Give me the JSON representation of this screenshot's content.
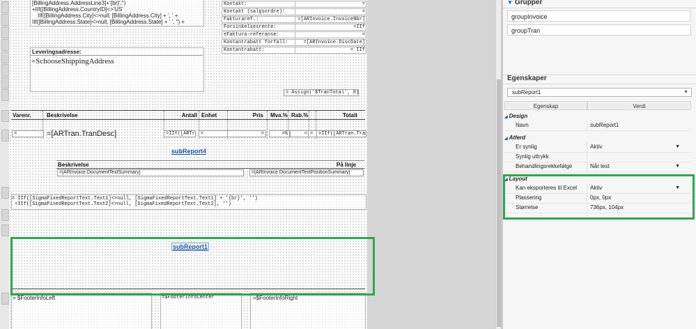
{
  "designer": {
    "billing": {
      "line1": "[BillingAddress.AddressLine3]+'{br}','')",
      "line2": "+IIf([BillingAddress.CountryID]<>'US'",
      "line3": "IIf([BillingAddress.City]<>null, [BillingAddress.City] + ', ' +",
      "line4": "IIf([BillingAddress.State]<>null, [BillingAddress.State] + ' ', '') +"
    },
    "info_rows": [
      {
        "label": "Kontakt:",
        "value": "="
      },
      {
        "label": "Kontakt (salgsordre):",
        "value": "="
      },
      {
        "label": "Fakturaref.:",
        "value": "=[ARInvoice.InvoiceNbr]"
      },
      {
        "label": "Forsinkelsesrente:",
        "value": "=IIf"
      },
      {
        "label": "eFaktura-referanse:",
        "value": "="
      },
      {
        "label": "Kontantrabatt forfall:",
        "value": "=[ARInvoice.DiscDate]"
      },
      {
        "label": "Kontantrabatt:",
        "value": "= IIf"
      }
    ],
    "shipping_label": "Leveringsadresse:",
    "shipping_expr": "=SchooseShippingAddress",
    "assign_expr": "= Assign('$TranTotal', 0)",
    "columns": [
      "Varenr.",
      "Beskrivelse",
      "Antall",
      "Enhet",
      "Pris",
      "Mva.%",
      "Rab.%",
      "Totalt"
    ],
    "detail_fields": {
      "varenr": "=",
      "trandesc": "=[ARTran.TranDesc]",
      "antall": "=IIf([ARTran",
      "enhet": "=",
      "pris": "=",
      "mva": "=%",
      "rab": "=",
      "rab2": "=",
      "totalt": "=IIf([ARTran.Tran"
    },
    "subreport4": "subReport4",
    "sub4_header_left": "Beskrivelse",
    "sub4_header_right": "På linje",
    "sub4_field_left": "=[ARInvoice.DocumentTextSummary]",
    "sub4_field_right": "=[ARInvoice.DocumentTextPositionSummary]",
    "sigma_line1": "= IIf([SigmaFixedReportText.Text1]<>null, [SigmaFixedReportText.Text1] + '{br}', '')",
    "sigma_line2": "+IIf([SigmaFixedReportText.Text2]<>null, [SigmaFixedReportText.Text2], '')",
    "subreport1": "subReport1",
    "footer_left": "= $FooterInfoLeft",
    "footer_center": "=$FooterInfoCenter",
    "footer_right": "=$FooterInfoRight"
  },
  "panel": {
    "groups_title": "Grupper",
    "groups": [
      "groupInvoice",
      "groupTran"
    ],
    "props_title": "Egenskaper",
    "selected_object": "subReport1",
    "grid_headers": {
      "property": "Egenskap",
      "value": "Verdi"
    },
    "categories": [
      {
        "name": "Design",
        "rows": [
          {
            "key": "Navn",
            "value": "subReport1",
            "dropdown": false
          }
        ]
      },
      {
        "name": "Atferd",
        "rows": [
          {
            "key": "Er synlig",
            "value": "Aktiv",
            "dropdown": true
          },
          {
            "key": "Synlig uttrykk",
            "value": "",
            "dropdown": false
          },
          {
            "key": "Behandlingsrekkefølge",
            "value": "Når lest",
            "dropdown": true
          }
        ]
      },
      {
        "name": "Layout",
        "rows": [
          {
            "key": "Kan eksporteres til Excel",
            "value": "Aktiv",
            "dropdown": true
          },
          {
            "key": "Plassering",
            "value": "0px, 0px",
            "dropdown": false
          },
          {
            "key": "Størrelse",
            "value": "736px, 104px",
            "dropdown": false
          }
        ]
      }
    ]
  },
  "highlight_color": "#2da84a",
  "link_color": "#1d57a8"
}
